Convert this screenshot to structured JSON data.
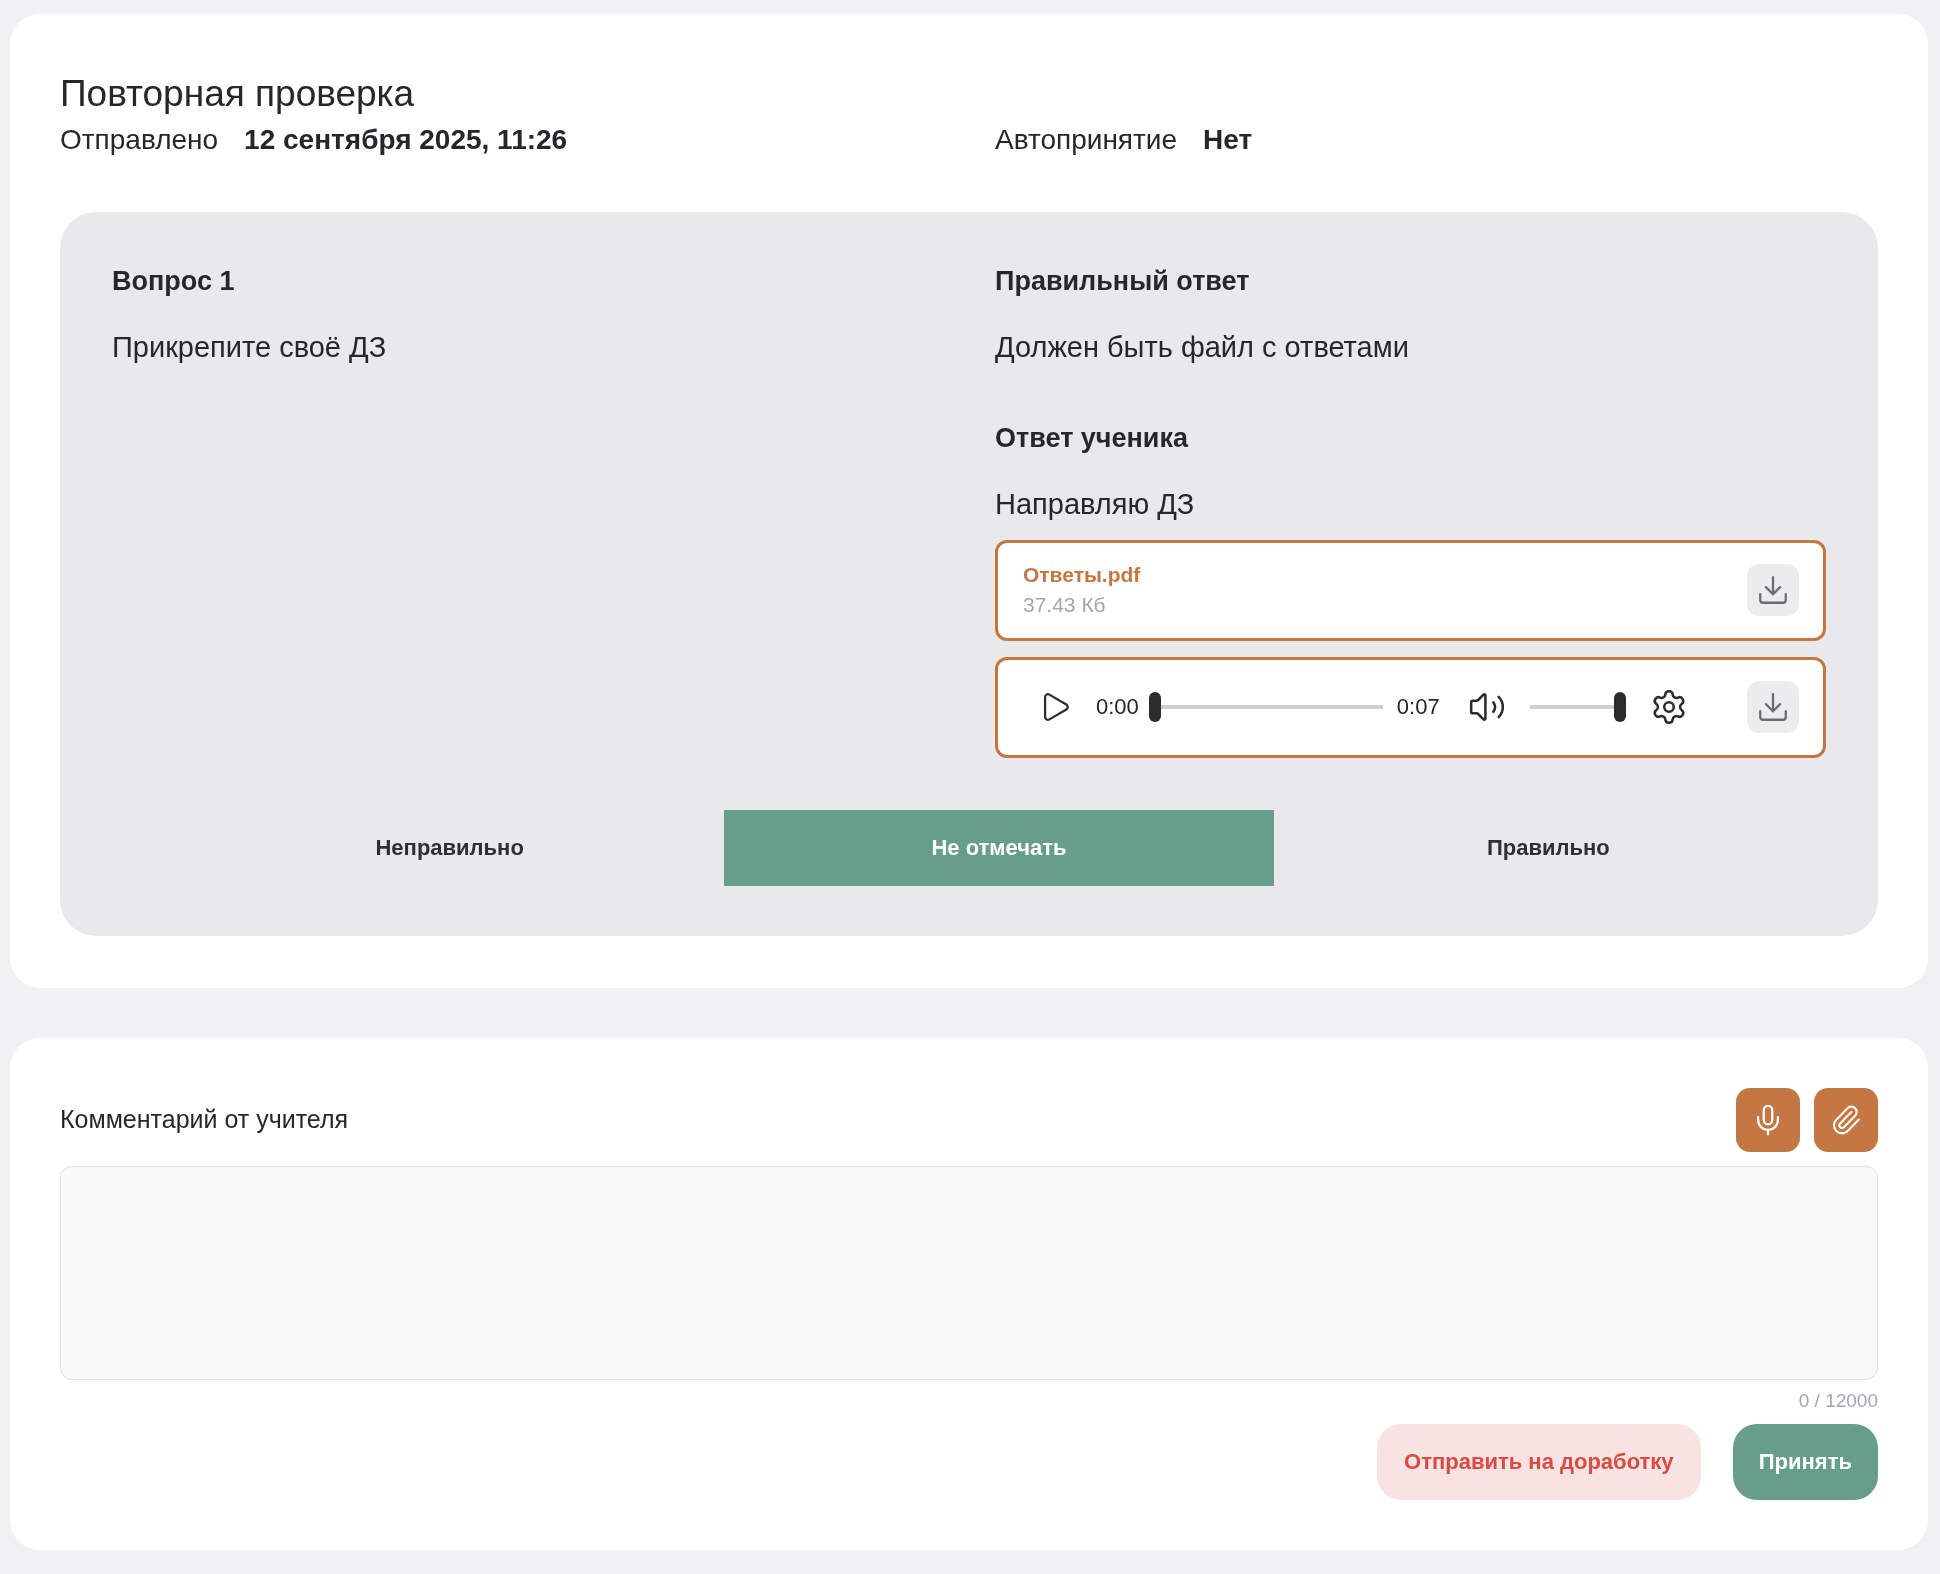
{
  "header": {
    "title": "Повторная проверка",
    "sent_label": "Отправлено",
    "sent_value": "12 сентября 2025, 11:26",
    "auto_label": "Автопринятие",
    "auto_value": "Нет"
  },
  "question": {
    "heading": "Вопрос 1",
    "text": "Прикрепите своё ДЗ",
    "correct_heading": "Правильный ответ",
    "correct_text": "Должен быть файл с ответами",
    "student_heading": "Ответ ученика",
    "student_text": "Направляю ДЗ",
    "file": {
      "name": "Ответы.pdf",
      "size": "37.43 Кб"
    },
    "audio": {
      "current": "0:00",
      "duration": "0:07",
      "progress": {
        "level": 0
      },
      "volume": {
        "level": 1
      }
    },
    "marks": [
      {
        "label": "Неправильно",
        "selected": false
      },
      {
        "label": "Не отмечать",
        "selected": true
      },
      {
        "label": "Правильно",
        "selected": false
      }
    ]
  },
  "comment": {
    "label": "Комментарий от учителя",
    "counter": "0 / 12000",
    "buttons": [
      {
        "label": "Отправить на доработку",
        "kind": "reject"
      },
      {
        "label": "Принять",
        "kind": "accept"
      }
    ]
  }
}
